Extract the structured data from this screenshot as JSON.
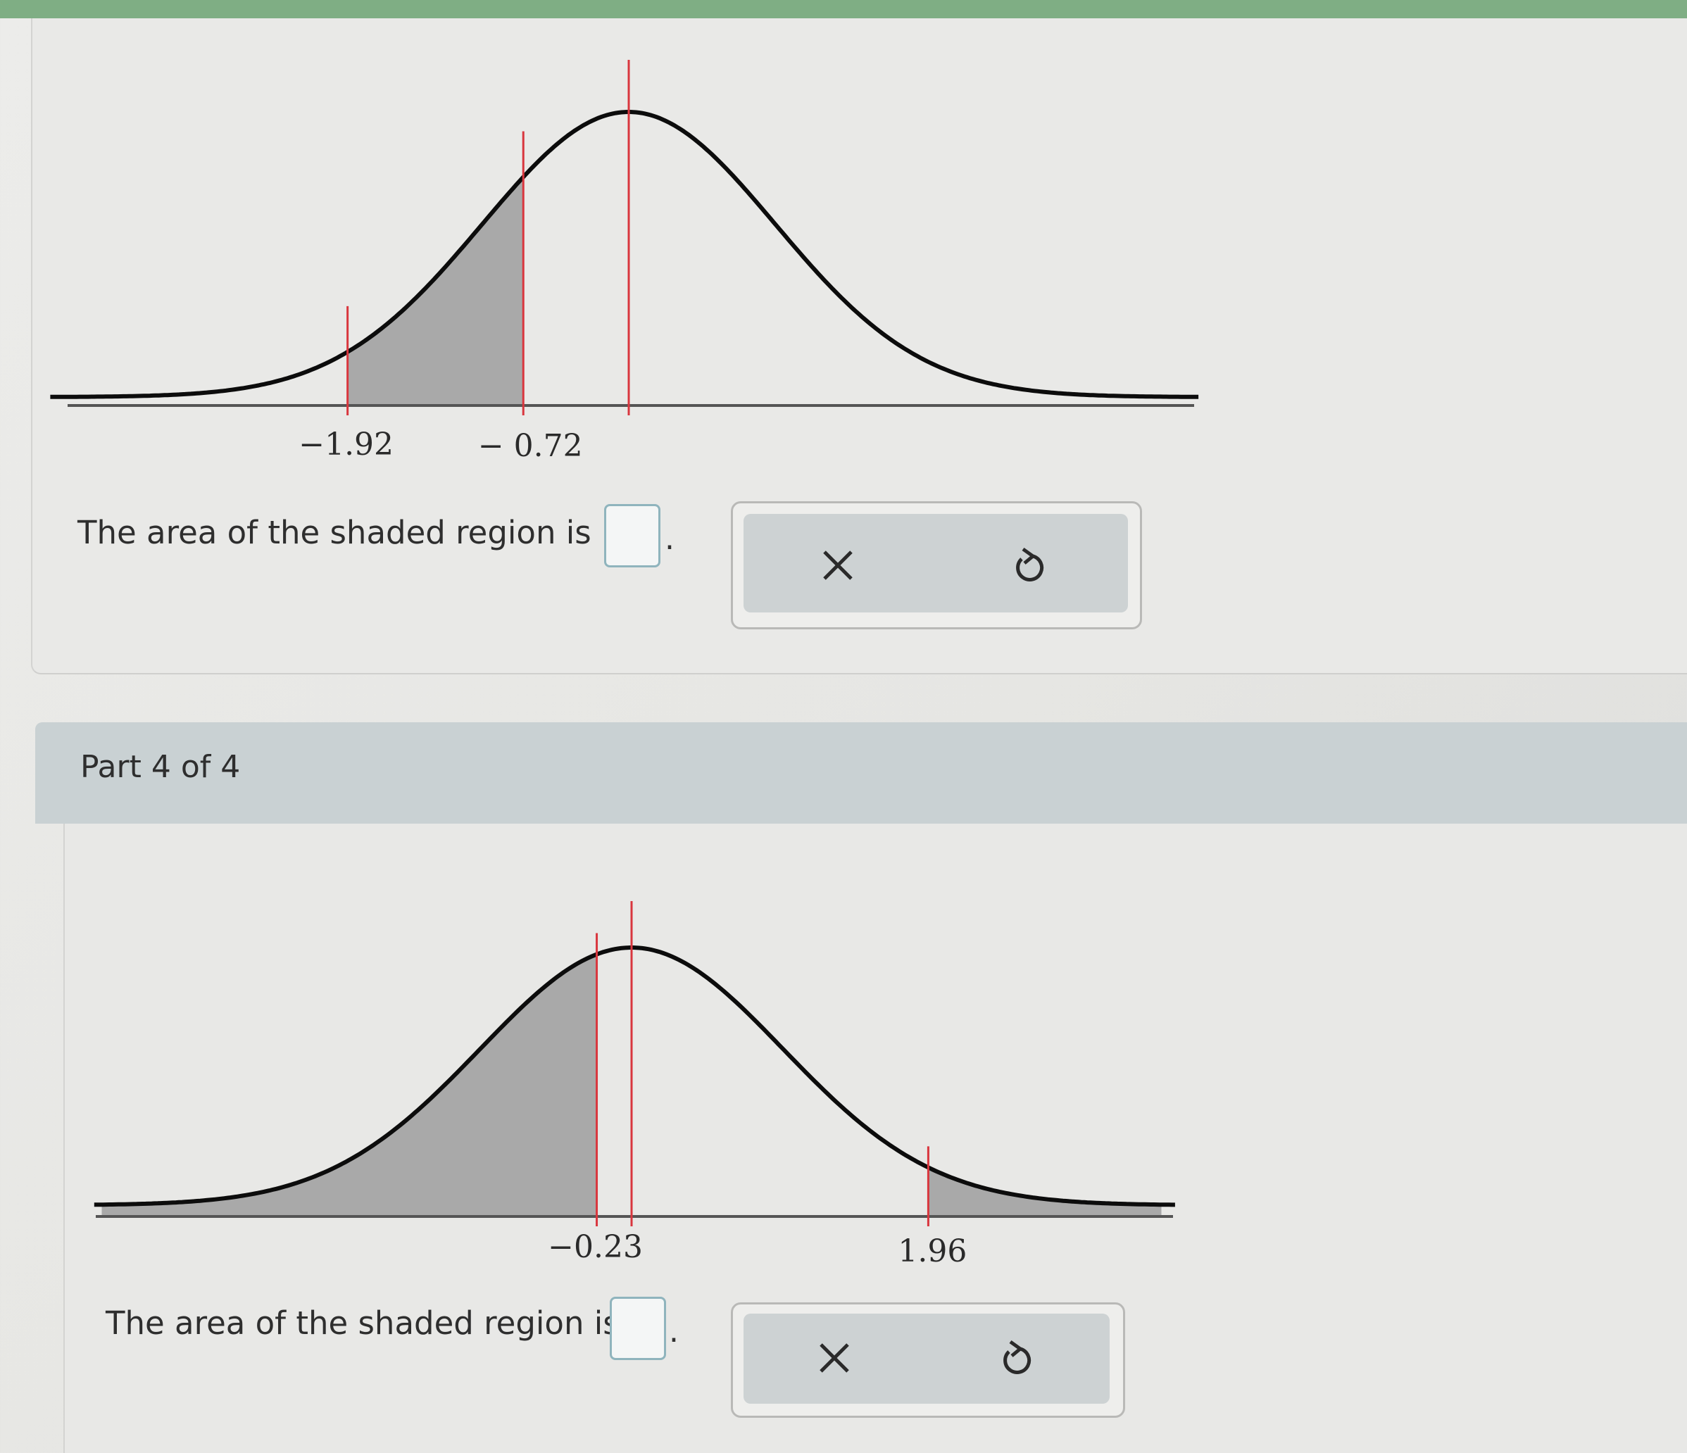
{
  "part3": {
    "question_text": "The area of the shaded region is",
    "answer_value": "",
    "period": ".",
    "chart_data": {
      "type": "area",
      "curve": "standard normal density",
      "marked_z": [
        -1.92,
        -0.72
      ],
      "tick_labels": [
        "−1.92",
        "− 0.72"
      ],
      "mean_line_z": 0,
      "shaded": [
        {
          "from": -1.92,
          "to": -0.72
        }
      ],
      "line_color": "#d9363e",
      "fill_color": "#a9a9a9"
    }
  },
  "part4": {
    "header_label": "Part 4 of 4",
    "question_text": "The area of the shaded region is",
    "answer_value": "",
    "period": ".",
    "chart_data": {
      "type": "area",
      "curve": "standard normal density",
      "marked_z": [
        -0.23,
        1.96
      ],
      "tick_labels": [
        "−0.23",
        "1.96"
      ],
      "mean_line_z": 0,
      "shaded": [
        {
          "from": -3.5,
          "to": -0.23
        },
        {
          "from": 1.96,
          "to": 3.5
        }
      ],
      "line_color": "#d9363e",
      "fill_color": "#a9a9a9"
    }
  },
  "buttons": {
    "clear_icon": "close-icon",
    "undo_icon": "undo-icon"
  },
  "colors": {
    "accent_bar": "#7fae84",
    "header_bg": "#c9d1d3",
    "answer_border": "#8fb4bd"
  }
}
